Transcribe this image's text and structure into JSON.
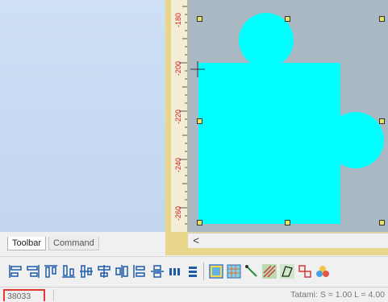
{
  "panel_tabs": {
    "toolbar": "Toolbar",
    "command": "Command"
  },
  "ruler": {
    "labels": [
      "-180",
      "-200",
      "-220",
      "-240",
      "-260"
    ]
  },
  "scrollbar": {
    "left_arrow": "<"
  },
  "status": {
    "code": "38033",
    "tatami": "Tatami: S = 1.00 L = 4.00"
  },
  "colors": {
    "shape_fill": "#00ffff",
    "canvas_bg": "#aab8c4",
    "handle_fill": "#e8e266",
    "ruler_text": "#cc2020",
    "frame": "#e8d68a"
  },
  "toolbar_icons": [
    "align-left-icon",
    "align-right-icon",
    "align-top-icon",
    "align-bottom-icon",
    "align-center-horizontal-icon",
    "align-center-vertical-icon",
    "align-middle-icon",
    "distribute-horizontal-icon",
    "distribute-vertical-icon",
    "make-same-width-icon",
    "make-same-height-icon",
    "select-object-icon",
    "grid-icon",
    "line-tool-icon",
    "fill-pattern-icon",
    "shape-edit-icon",
    "node-tool-icon",
    "color-icon"
  ]
}
